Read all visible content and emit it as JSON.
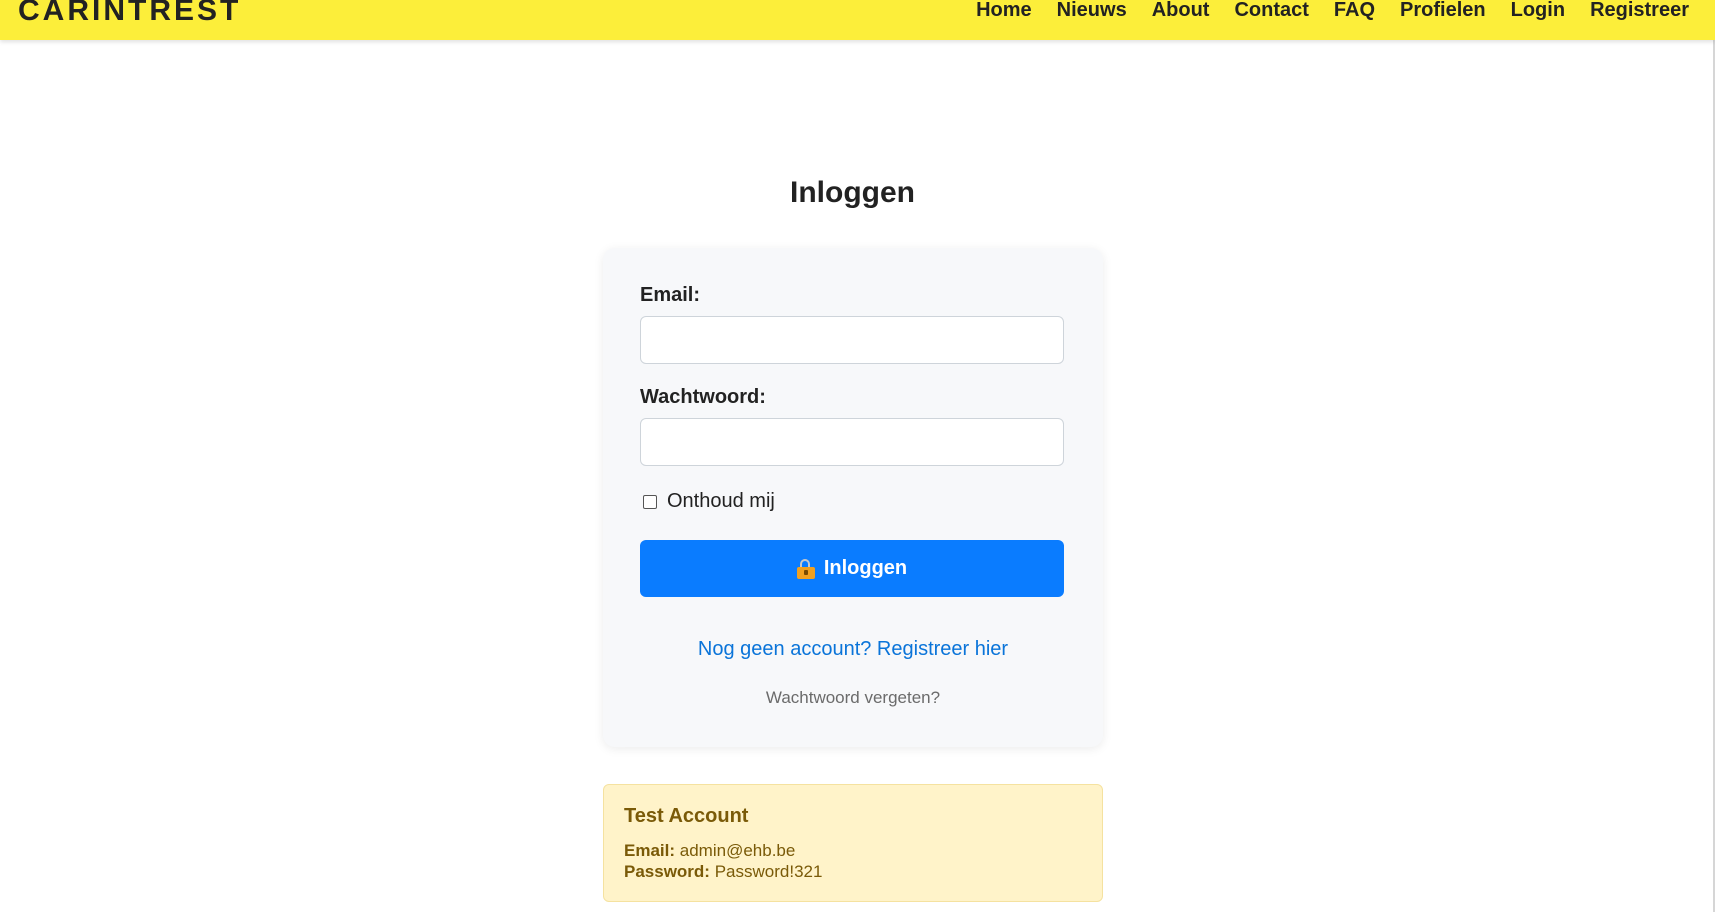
{
  "navbar": {
    "brand": "CARINTREST",
    "links": [
      "Home",
      "Nieuws",
      "About",
      "Contact",
      "FAQ",
      "Profielen",
      "Login",
      "Registreer"
    ],
    "background_color": "#fcee3a"
  },
  "main": {
    "title": "Inloggen"
  },
  "login_form": {
    "email_label": "Email:",
    "email_value": "",
    "password_label": "Wachtwoord:",
    "password_value": "",
    "remember_label": "Onthoud mij",
    "remember_checked": false,
    "submit_label": "Inloggen",
    "submit_icon": "lock-icon",
    "submit_color": "#0a7cff",
    "register_link": "Nog geen account? Registreer hier",
    "forgot_link": "Wachtwoord vergeten?"
  },
  "test_account": {
    "title": "Test Account",
    "email_label": "Email:",
    "email_value": "admin@ehb.be",
    "password_label": "Password:",
    "password_value": "Password!321",
    "background_color": "#fff3c9"
  }
}
